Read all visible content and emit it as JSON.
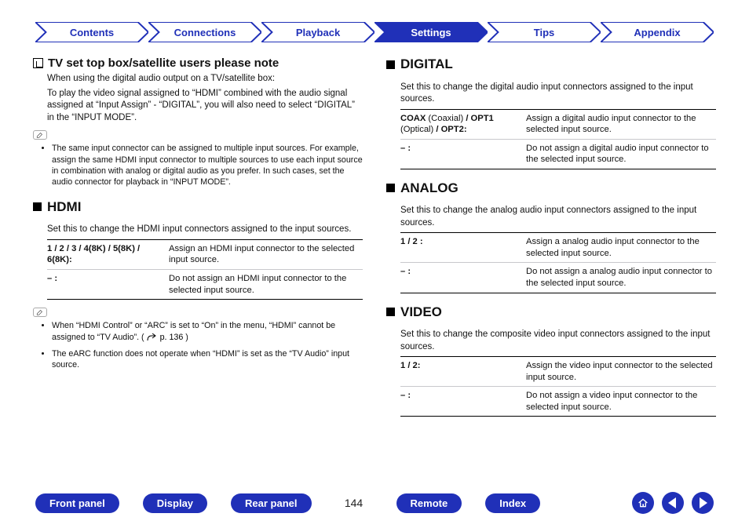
{
  "tabs": {
    "contents": "Contents",
    "connections": "Connections",
    "playback": "Playback",
    "settings": "Settings",
    "tips": "Tips",
    "appendix": "Appendix"
  },
  "left": {
    "note_heading": "TV set top box/satellite users please note",
    "note_p1": "When using the digital audio output on a TV/satellite box:",
    "note_p2": "To play the video signal assigned to “HDMI” combined with the audio signal assigned at “Input Assign” - “DIGITAL”, you will also need to select “DIGITAL” in the “INPUT MODE”.",
    "note_bullet1": "The same input connector can be assigned to multiple input sources. For example, assign the same HDMI input connector to multiple sources to use each input source in combination with analog or digital audio as you prefer. In such cases, set the audio connector for playback in “INPUT MODE”.",
    "hdmi": {
      "title": "HDMI",
      "desc": "Set this to change the HDMI input connectors assigned to the input sources.",
      "row1_key": "1 / 2 / 3 / 4(8K) / 5(8K) / 6(8K):",
      "row1_val": "Assign an HDMI input connector to the selected input source.",
      "row2_key": "– :",
      "row2_val": "Do not assign an HDMI input connector to the selected input source.",
      "tip1_prefix": "When “HDMI Control” or “ARC” is set to “On” in the menu, “HDMI” cannot be assigned to “TV Audio”.  (",
      "tip1_link": "p. 136",
      "tip1_suffix": ")",
      "tip2": "The eARC function does not operate when “HDMI” is set as the “TV Audio” input source."
    }
  },
  "right": {
    "digital": {
      "title": "DIGITAL",
      "desc": "Set this to change the digital audio input connectors assigned to the input sources.",
      "row1_key_b1": "COAX",
      "row1_key_t1": " (Coaxial) ",
      "row1_key_b2": "/ OPT1",
      "row1_key_t2": " (Optical) ",
      "row1_key_b3": "/ OPT2:",
      "row1_val": "Assign a digital audio input connector to the selected input source.",
      "row2_key": "– :",
      "row2_val": "Do not assign a digital audio input connector to the selected input source."
    },
    "analog": {
      "title": "ANALOG",
      "desc": "Set this to change the analog audio input connectors assigned to the input sources.",
      "row1_key": "1 / 2 :",
      "row1_val": "Assign a analog audio input connector to the selected input source.",
      "row2_key": "– :",
      "row2_val": "Do not assign a analog audio input connector to the selected input source."
    },
    "video": {
      "title": "VIDEO",
      "desc": "Set this to change the composite video input connectors assigned to the input sources.",
      "row1_key": "1 / 2:",
      "row1_val": "Assign the video input connector to the selected input source.",
      "row2_key": "– :",
      "row2_val": "Do not assign a video input connector to the selected input source."
    }
  },
  "footer": {
    "front_panel": "Front panel",
    "display": "Display",
    "rear_panel": "Rear panel",
    "remote": "Remote",
    "index": "Index",
    "page": "144"
  }
}
